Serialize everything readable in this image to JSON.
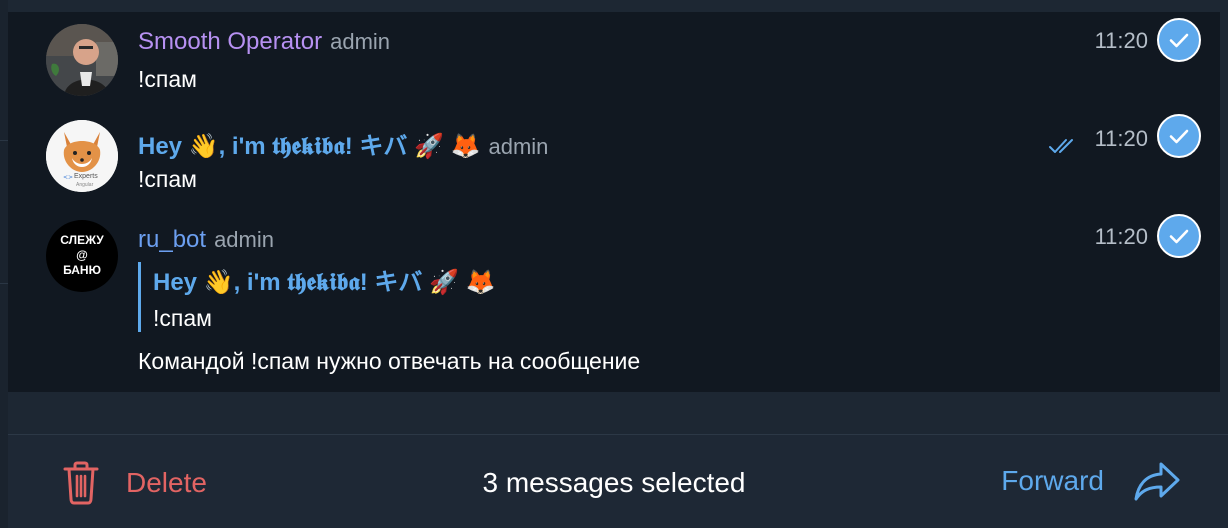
{
  "colors": {
    "accent": "#5ea9ec",
    "purple_name": "#b791f2",
    "blue_name": "#5ea9ec",
    "danger": "#e26463",
    "background": "#1d2733",
    "selected_background": "#111821"
  },
  "messages": [
    {
      "sender": "Smooth Operator",
      "role": "admin",
      "text": "!спам",
      "time": "11:20",
      "name_color": "#b791f2",
      "avatar_icon": "person-photo-avatar"
    },
    {
      "sender": "Hey 👋, i'm 𝖙𝖍𝖊𝖐𝖎𝖇𝖆! キバ 🚀 🦊",
      "role": "admin",
      "text": "!спам",
      "time": "11:20",
      "name_color": "#5ea9ec",
      "avatar_icon": "fox-avatar",
      "avatar_caption": "Experts",
      "avatar_subcaption": "Angular",
      "read_status": "double-check-icon"
    },
    {
      "sender": "ru_bot",
      "role": "admin",
      "reply_to": {
        "sender": "Hey 👋, i'm 𝖙𝖍𝖊𝖐𝖎𝖇𝖆! キバ 🚀 🦊",
        "text": "!спам"
      },
      "text": "Командой !спам нужно отвечать на сообщение",
      "time": "11:20",
      "name_color": "#6c9ff0",
      "avatar_lines": [
        "СЛЕЖУ",
        "@",
        "БАНЮ"
      ]
    }
  ],
  "bottom_bar": {
    "delete_label": "Delete",
    "selected_text": "3 messages selected",
    "forward_label": "Forward",
    "delete_icon": "trash-icon",
    "forward_icon": "forward-arrow-icon"
  }
}
